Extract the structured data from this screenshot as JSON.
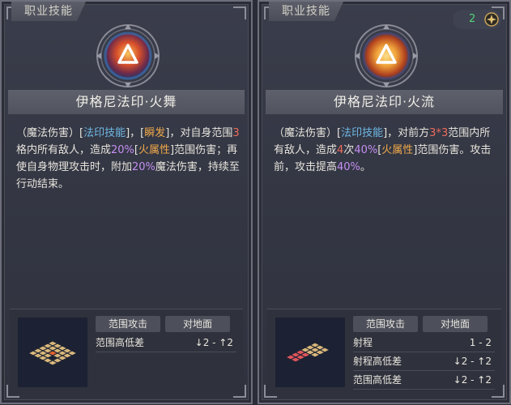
{
  "left_card": {
    "tag": "职业技能",
    "title": "伊格尼法印·火舞",
    "desc": {
      "p1": "（魔法伤害）[",
      "skill_type": "法印技能",
      "p2": "]，[",
      "instant": "瞬发",
      "p3": "]，对自身范围",
      "range": "3",
      "p4": "格内所有敌人，造成",
      "pct1": "20%",
      "elem_open": "[",
      "elem": "火属性",
      "elem_close": "]",
      "p5": "范围伤害；再使自身物理攻击时，附加",
      "pct2": "20%",
      "p6": "魔法伤害，持续至行动结束。"
    },
    "tags": [
      "范围攻击",
      "对地面"
    ],
    "rows": [
      {
        "label": "范围高低差",
        "value": "↓2 - ↑2"
      }
    ]
  },
  "right_card": {
    "tag": "职业技能",
    "counter": "2",
    "title": "伊格尼法印·火流",
    "desc": {
      "p1": "（魔法伤害）[",
      "skill_type": "法印技能",
      "p2": "]，对前方",
      "area": "3*3",
      "p3": "范围内所有敌人，造成",
      "times": "4",
      "p4": "次",
      "pct1": "40%",
      "elem_open": "[",
      "elem": "火属性",
      "elem_close": "]",
      "p5": "范围伤害。攻击前，攻击提高",
      "pct2": "40%",
      "p6": "。"
    },
    "tags": [
      "范围攻击",
      "对地面"
    ],
    "rows": [
      {
        "label": "射程",
        "value": "1 - 2"
      },
      {
        "label": "射程高低差",
        "value": "↓2 - ↑2"
      },
      {
        "label": "范围高低差",
        "value": "↓2 - ↑2"
      }
    ]
  },
  "colors": {
    "skill_blue": "#6fb8e6",
    "instant_orange": "#f0a94a",
    "number_red": "#ef6b5a",
    "percent_purple": "#c58ff3",
    "counter_green": "#54d27a"
  },
  "icons": {
    "emblem": "fire-sign-icon",
    "counter": "gear-coin-icon"
  }
}
